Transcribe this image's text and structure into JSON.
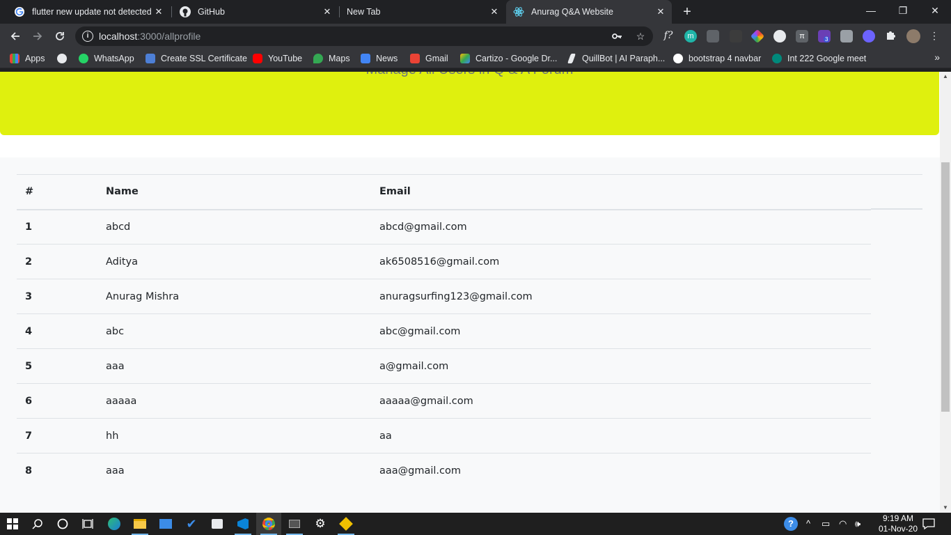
{
  "browser": {
    "tabs": [
      {
        "title": "flutter new update not detected …",
        "active": false,
        "favicon": "google-icon"
      },
      {
        "title": "GitHub",
        "active": false,
        "favicon": "github-icon"
      },
      {
        "title": "New Tab",
        "active": false,
        "favicon": ""
      },
      {
        "title": "Anurag Q&A Website",
        "active": true,
        "favicon": "react-icon"
      }
    ],
    "url_host": "localhost",
    "url_rest": ":3000/allprofile",
    "bookmarks": [
      {
        "label": "Apps",
        "icon": "apps-grid-icon"
      },
      {
        "label": "",
        "icon": "globe-icon"
      },
      {
        "label": "WhatsApp",
        "icon": "whatsapp-icon"
      },
      {
        "label": "Create SSL Certificate",
        "icon": "puzzle-icon"
      },
      {
        "label": "YouTube",
        "icon": "youtube-icon"
      },
      {
        "label": "Maps",
        "icon": "maps-icon"
      },
      {
        "label": "News",
        "icon": "news-icon"
      },
      {
        "label": "Gmail",
        "icon": "gmail-icon"
      },
      {
        "label": "Cartizo - Google Dr...",
        "icon": "drive-icon"
      },
      {
        "label": "QuillBot | AI Paraph...",
        "icon": "quill-icon"
      },
      {
        "label": "bootstrap 4 navbar",
        "icon": "bootstrap-icon"
      },
      {
        "label": "Int 222 Google meet",
        "icon": "meet-icon"
      }
    ],
    "extension_badge": "3"
  },
  "page": {
    "hero_subtitle": "Manage All Users in Q & A Forum",
    "table": {
      "headers": [
        "#",
        "Name",
        "Email"
      ],
      "rows": [
        {
          "num": "1",
          "name": "abcd",
          "email": "abcd@gmail.com"
        },
        {
          "num": "2",
          "name": "Aditya",
          "email": "ak6508516@gmail.com"
        },
        {
          "num": "3",
          "name": "Anurag Mishra",
          "email": "anuragsurfing123@gmail.com"
        },
        {
          "num": "4",
          "name": "abc",
          "email": "abc@gmail.com"
        },
        {
          "num": "5",
          "name": "aaa",
          "email": "a@gmail.com"
        },
        {
          "num": "6",
          "name": "aaaaa",
          "email": "aaaaa@gmail.com"
        },
        {
          "num": "7",
          "name": "hh",
          "email": "aa"
        },
        {
          "num": "8",
          "name": "aaa",
          "email": "aaa@gmail.com"
        }
      ]
    }
  },
  "taskbar": {
    "time": "9:19 AM",
    "date": "01-Nov-20"
  },
  "colors": {
    "hero_bg": "#dff00e",
    "table_bg": "#f8f9fa",
    "chrome_dark": "#202124",
    "chrome_toolbar": "#35363a"
  }
}
